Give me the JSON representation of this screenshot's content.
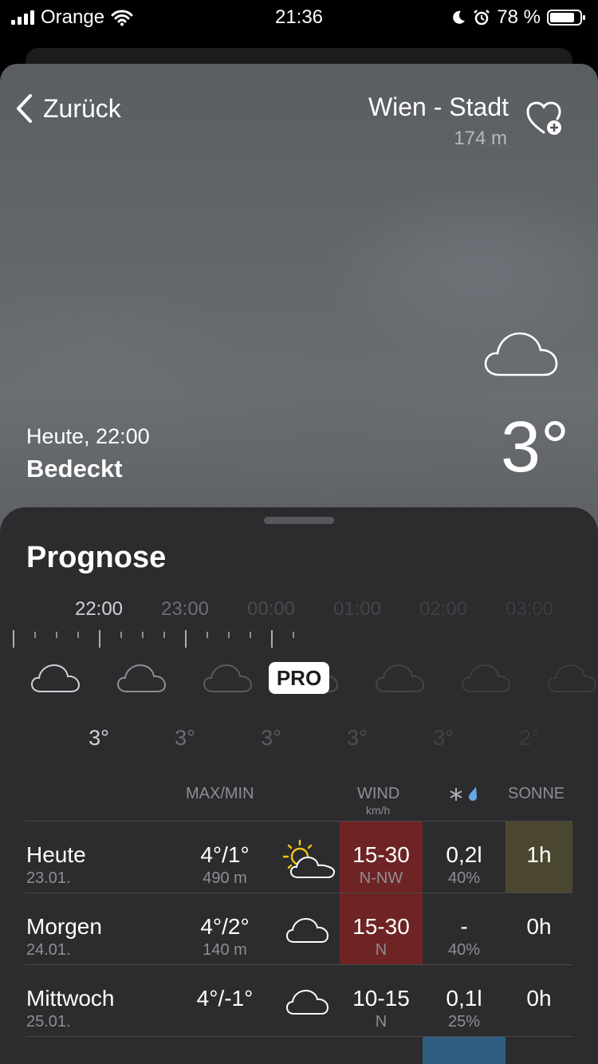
{
  "status_bar": {
    "carrier": "Orange",
    "time": "21:36",
    "battery": "78 %"
  },
  "header": {
    "back_label": "Zurück",
    "city": "Wien - Stadt",
    "altitude": "174 m"
  },
  "current": {
    "when": "Heute, 22:00",
    "condition": "Bedeckt",
    "temperature": "3°"
  },
  "forecast": {
    "title": "Prognose",
    "hours": [
      "22:00",
      "23:00",
      "00:00",
      "01:00",
      "02:00",
      "03:00"
    ],
    "hour_temps": [
      "3°",
      "3°",
      "3°",
      "3°",
      "3°",
      "2°"
    ],
    "pro_badge": "PRO"
  },
  "table": {
    "headers": {
      "maxmin": "MAX/MIN",
      "wind": "WIND",
      "wind_unit": "km/h",
      "sun": "SONNE"
    },
    "rows": [
      {
        "day": "Heute",
        "date": "23.01.",
        "maxmin": "4°/1°",
        "snowline": "490 m",
        "icon": "sun-cloud-icon",
        "wind": "15-30",
        "wind_dir": "N-NW",
        "precip": "0,2l",
        "precip_prob": "40%",
        "sun": "1h"
      },
      {
        "day": "Morgen",
        "date": "24.01.",
        "maxmin": "4°/2°",
        "snowline": "140 m",
        "icon": "cloud-icon",
        "wind": "15-30",
        "wind_dir": "N",
        "precip": "-",
        "precip_prob": "40%",
        "sun": "0h"
      },
      {
        "day": "Mittwoch",
        "date": "25.01.",
        "maxmin": "4°/-1°",
        "snowline": "",
        "icon": "cloud-icon",
        "wind": "10-15",
        "wind_dir": "N",
        "precip": "0,1l",
        "precip_prob": "25%",
        "sun": "0h"
      }
    ]
  },
  "colors": {
    "wind_high": "#6e2424",
    "sun_highlight": "#4a4630",
    "precip_highlight": "#2f5d80"
  }
}
